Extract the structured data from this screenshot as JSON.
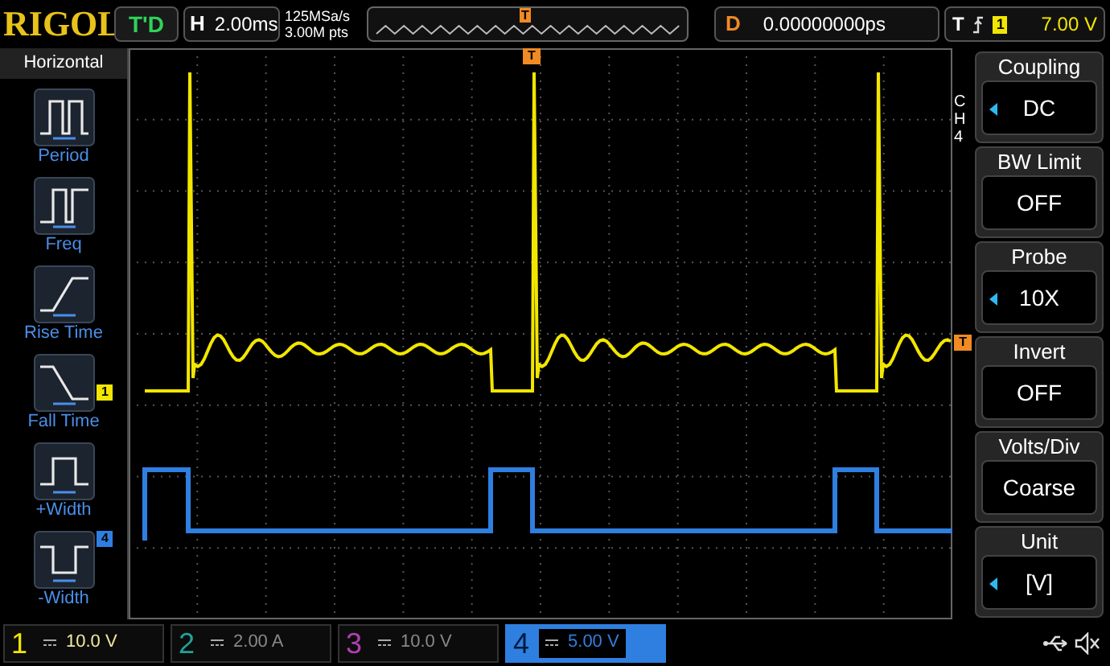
{
  "top_bar": {
    "logo": "RIGOL",
    "run_state": "T'D",
    "horizontal": {
      "label": "H",
      "value": "2.00ms"
    },
    "sample_rate": "125MSa/s",
    "memory_depth": "3.00M pts",
    "overview_marker": "T",
    "delay": {
      "label": "D",
      "value": "0.00000000ps"
    },
    "trigger": {
      "label": "T",
      "source": "1",
      "level": "7.00 V"
    }
  },
  "left_panel": {
    "title": "Horizontal",
    "items": [
      {
        "kind": "period",
        "label": "Period"
      },
      {
        "kind": "freq",
        "label": "Freq"
      },
      {
        "kind": "rise",
        "label": "Rise Time"
      },
      {
        "kind": "fall",
        "label": "Fall Time"
      },
      {
        "kind": "pwidth",
        "label": "+Width"
      },
      {
        "kind": "nwidth",
        "label": "-Width"
      }
    ]
  },
  "graticule": {
    "markers": [
      {
        "kind": "trigger_position",
        "label": "T",
        "color": "#f08a24"
      },
      {
        "kind": "trigger_level",
        "label": "T",
        "color": "#f08a24"
      },
      {
        "kind": "channel",
        "label": "1",
        "color": "#f2e600"
      },
      {
        "kind": "channel",
        "label": "4",
        "color": "#2f7fe0"
      }
    ]
  },
  "right_menu": {
    "channel_label": "CH4",
    "items": [
      {
        "title": "Coupling",
        "value": "DC",
        "adjustable": true
      },
      {
        "title": "BW Limit",
        "value": "OFF",
        "adjustable": false
      },
      {
        "title": "Probe",
        "value": "10X",
        "adjustable": true
      },
      {
        "title": "Invert",
        "value": "OFF",
        "adjustable": false
      },
      {
        "title": "Volts/Div",
        "value": "Coarse",
        "adjustable": false
      },
      {
        "title": "Unit",
        "value": "[V]",
        "adjustable": true
      }
    ]
  },
  "channels": [
    {
      "number": "1",
      "scale": "10.0 V",
      "color": "#f2e600",
      "enabled": true,
      "selected": false
    },
    {
      "number": "2",
      "scale": "2.00 A",
      "color": "#1fa39a",
      "enabled": false,
      "selected": false
    },
    {
      "number": "3",
      "scale": "10.0 V",
      "color": "#b03fb0",
      "enabled": false,
      "selected": false
    },
    {
      "number": "4",
      "scale": "5.00 V",
      "color": "#2f7fe0",
      "enabled": true,
      "selected": true
    }
  ]
}
